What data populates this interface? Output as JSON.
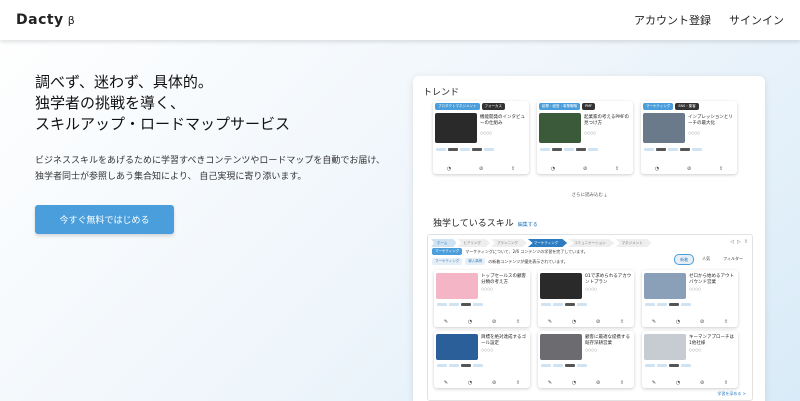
{
  "header": {
    "logo": "Dacty",
    "logo_beta": "β",
    "nav": {
      "register": "アカウント登録",
      "signin": "サインイン"
    }
  },
  "hero": {
    "headline_lines": [
      "調べず、迷わず、具体的。",
      "独学者の挑戦を導く、",
      "スキルアップ・ロードマップサービス"
    ],
    "desc_lines": [
      "ビジネススキルをあげるために学習すべきコンテンツやロードマップを自動でお届け、",
      "独学者同士が参照しあう集合知により、 自己実現に寄り添います。"
    ],
    "cta": "今すぐ無料ではじめる"
  },
  "preview": {
    "trend_title": "トレンド",
    "read_more": "さらに読み込む",
    "skills_title": "独学しているスキル",
    "skills_edit": "編集する",
    "trend_cards": [
      {
        "tags": [
          "プロダクトマネジメント",
          "フォーカス"
        ],
        "title": "機能開発のインタビューの仕組み",
        "author": "○○○○",
        "thumb": "#2a2a2a"
      },
      {
        "tags": [
          "起業・経営・事業戦略",
          "PMF"
        ],
        "title": "起業家の考えるPMFの見つけ方",
        "author": "○○○○",
        "thumb": "#3a5a3a"
      },
      {
        "tags": [
          "マーケティング",
          "SNS・集客"
        ],
        "title": "インプレッションとリーチの最大化",
        "author": "○○○○",
        "thumb": "#6a7a8a"
      }
    ],
    "steps": [
      "ホーム",
      "ヒアリング",
      "プランニング",
      "マーケティング",
      "コミュニケーション",
      "マネジメント"
    ],
    "status_label": "マーケティング",
    "status_text": "マーケティングについて、2/6 コンテンツの学習を完了しています。",
    "status2_tag1": "マーケティング",
    "status2_tag2": "導入事例",
    "status2_text": "の新着コンテンツが優先表示されています。",
    "tabs": [
      "新着",
      "人気",
      "フィルター"
    ],
    "skill_cards": [
      {
        "title": "トップセールスの顧客分類の考え方",
        "author": "○○○○",
        "thumb": "#f4b5c6"
      },
      {
        "title": "01で求められるアカウントプラン",
        "author": "○○○○",
        "thumb": "#2a2a2a"
      },
      {
        "title": "ゼロから始めるアウトバウンド営業",
        "author": "○○○○",
        "thumb": "#8aa0b8"
      },
      {
        "title": "目標を絶対達成するゴール設定",
        "author": "○○○○",
        "thumb": "#2b5f9a"
      },
      {
        "title": "顧客に最適な提携する既存深耕営業",
        "author": "○○○○",
        "thumb": "#6b6b70"
      },
      {
        "title": "キーマンアプローチは1他社様",
        "author": "○○○○",
        "thumb": "#c7ccd2"
      }
    ],
    "deepen": "学習を深める"
  },
  "colors": {
    "accent": "#4a9edb",
    "link": "#2d7cc1"
  }
}
